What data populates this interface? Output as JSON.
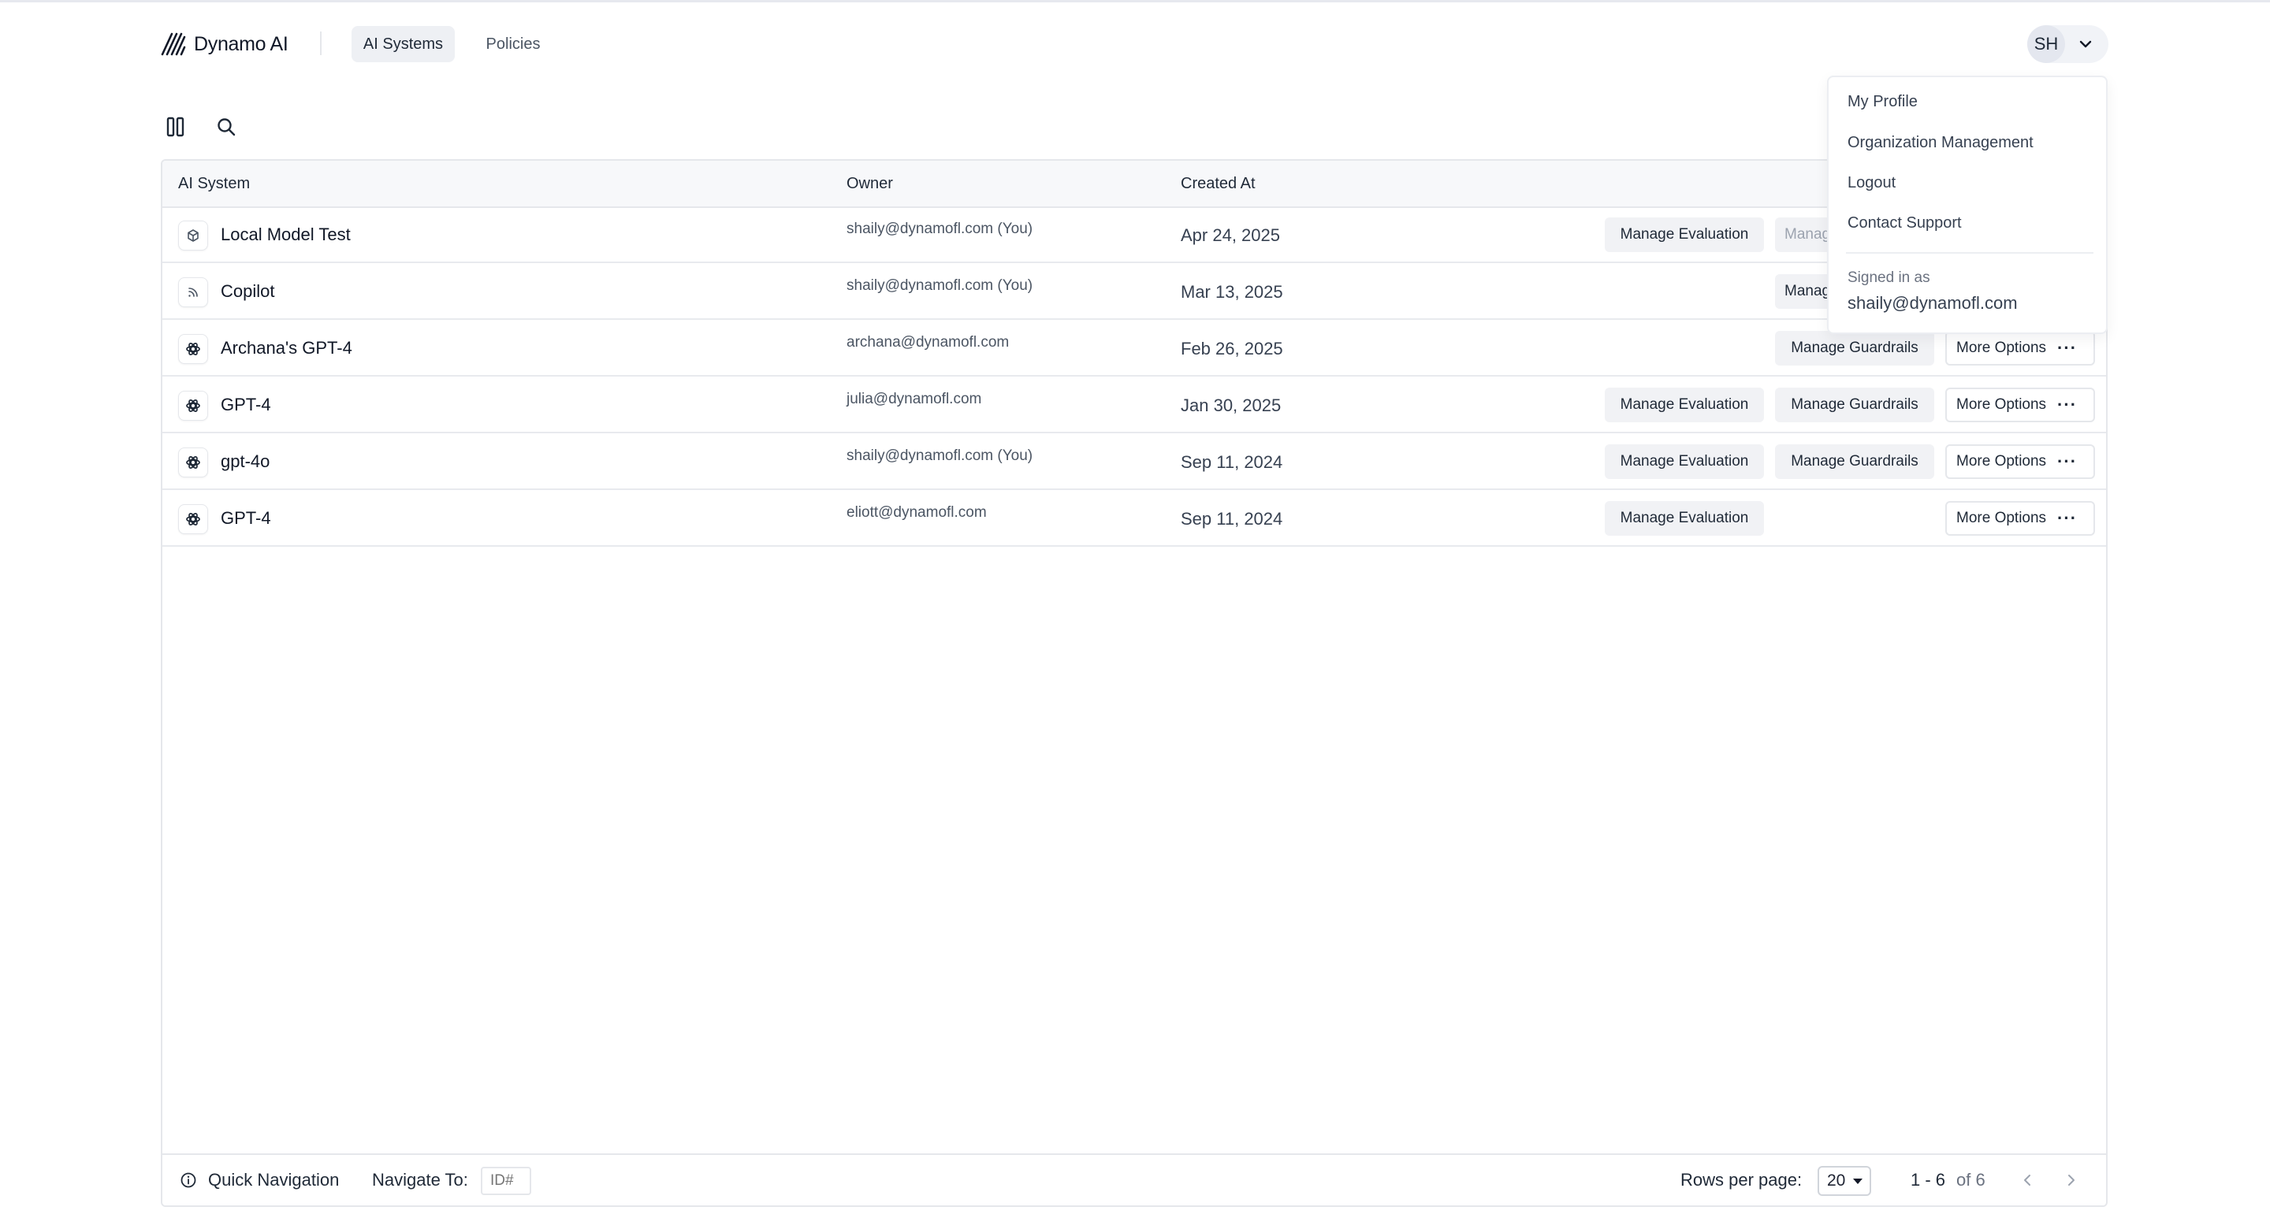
{
  "app": {
    "brand": "Dynamo AI"
  },
  "nav": {
    "tabs": [
      {
        "label": "AI Systems",
        "active": true
      },
      {
        "label": "Policies",
        "active": false
      }
    ]
  },
  "user": {
    "initials": "SH"
  },
  "toolbar": {
    "icons": [
      "columns-icon",
      "search-icon"
    ]
  },
  "table": {
    "columns": [
      "AI System",
      "Owner",
      "Created At"
    ],
    "rows": [
      {
        "name": "Local Model Test",
        "icon": "cube-icon",
        "owner": "shaily@dynamofl.com (You)",
        "created": "Apr 24, 2025",
        "buttons": [
          "Manage Evaluation",
          "Manag"
        ],
        "more": ""
      },
      {
        "name": "Copilot",
        "icon": "rss-icon",
        "owner": "shaily@dynamofl.com (You)",
        "created": "Mar 13, 2025",
        "buttons": [
          "Manag"
        ],
        "more": ""
      },
      {
        "name": "Archana's GPT-4",
        "icon": "openai-icon",
        "owner": "archana@dynamofl.com",
        "created": "Feb 26, 2025",
        "buttons": [
          "Manage Guardrails"
        ],
        "more": "More Options"
      },
      {
        "name": "GPT-4",
        "icon": "openai-icon",
        "owner": "julia@dynamofl.com",
        "created": "Jan 30, 2025",
        "buttons": [
          "Manage Evaluation",
          "Manage Guardrails"
        ],
        "more": "More Options"
      },
      {
        "name": "gpt-4o",
        "icon": "openai-icon",
        "owner": "shaily@dynamofl.com (You)",
        "created": "Sep 11, 2024",
        "buttons": [
          "Manage Evaluation",
          "Manage Guardrails"
        ],
        "more": "More Options"
      },
      {
        "name": "GPT-4",
        "icon": "openai-icon",
        "owner": "eliott@dynamofl.com",
        "created": "Sep 11, 2024",
        "buttons": [
          "Manage Evaluation"
        ],
        "more": "More Options"
      }
    ]
  },
  "footer": {
    "quick_nav": "Quick Navigation",
    "navigate_to": "Navigate To:",
    "id_placeholder": "ID#",
    "rows_per_page_label": "Rows per page:",
    "rows_per_page_value": "20",
    "range": "1 - 6",
    "of_total": "of 6"
  },
  "dropdown": {
    "items": [
      "My Profile",
      "Organization Management",
      "Logout",
      "Contact Support"
    ],
    "signed_in_label": "Signed in as",
    "signed_in_email": "shaily@dynamofl.com"
  }
}
